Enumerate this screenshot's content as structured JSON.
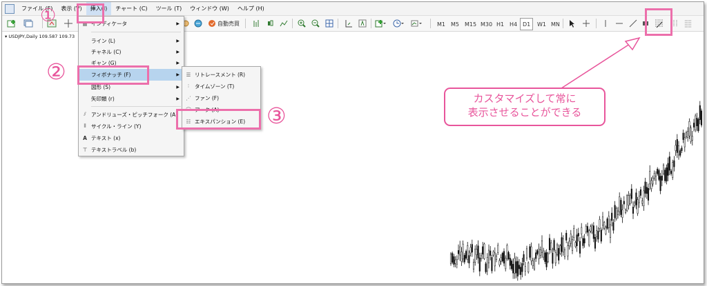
{
  "menubar": {
    "items": [
      "ファイル (F)",
      "表示 (V)",
      "挿入(I)",
      "チャート (C)",
      "ツール (T)",
      "ウィンドウ (W)",
      "ヘルプ (H)"
    ]
  },
  "toolbar": {
    "auto_trade_label": "自動売買",
    "timeframes": [
      "M1",
      "M5",
      "M15",
      "M30",
      "H1",
      "H4",
      "D1",
      "W1",
      "MN"
    ],
    "selected_timeframe": "D1"
  },
  "chart": {
    "symbol_label": "USDJPY,Daily  109.587 109.73"
  },
  "insert_menu": {
    "items": [
      {
        "label": "インディケータ",
        "submenu": true
      },
      {
        "label": "ライン (L)",
        "submenu": true
      },
      {
        "label": "チャネル (C)",
        "submenu": true
      },
      {
        "label": "ギャン (G)",
        "submenu": true
      },
      {
        "label": "フィボナッチ (F)",
        "submenu": true
      },
      {
        "label": "図形 (S)",
        "submenu": true
      },
      {
        "label": "矢印類 (r)",
        "submenu": true
      },
      {
        "label": "アンドリューズ・ピッチフォーク (A)",
        "submenu": false
      },
      {
        "label": "サイクル・ライン (Y)",
        "submenu": false
      },
      {
        "label": "テキスト (x)",
        "submenu": false
      },
      {
        "label": "テキストラベル (b)",
        "submenu": false
      }
    ]
  },
  "fibonacci_submenu": {
    "items": [
      "リトレースメント (R)",
      "タイムゾーン (T)",
      "ファン (F)",
      "アーク (A)",
      "エキスパンション (E)"
    ]
  },
  "annotations": {
    "step1": "①",
    "step2": "②",
    "step3": "③",
    "callout_line1": "カスタマイズして常に",
    "callout_line2": "表示させることができる"
  },
  "colors": {
    "accent_pink": "#e8559b",
    "menu_highlight": "#b7d4ee"
  }
}
